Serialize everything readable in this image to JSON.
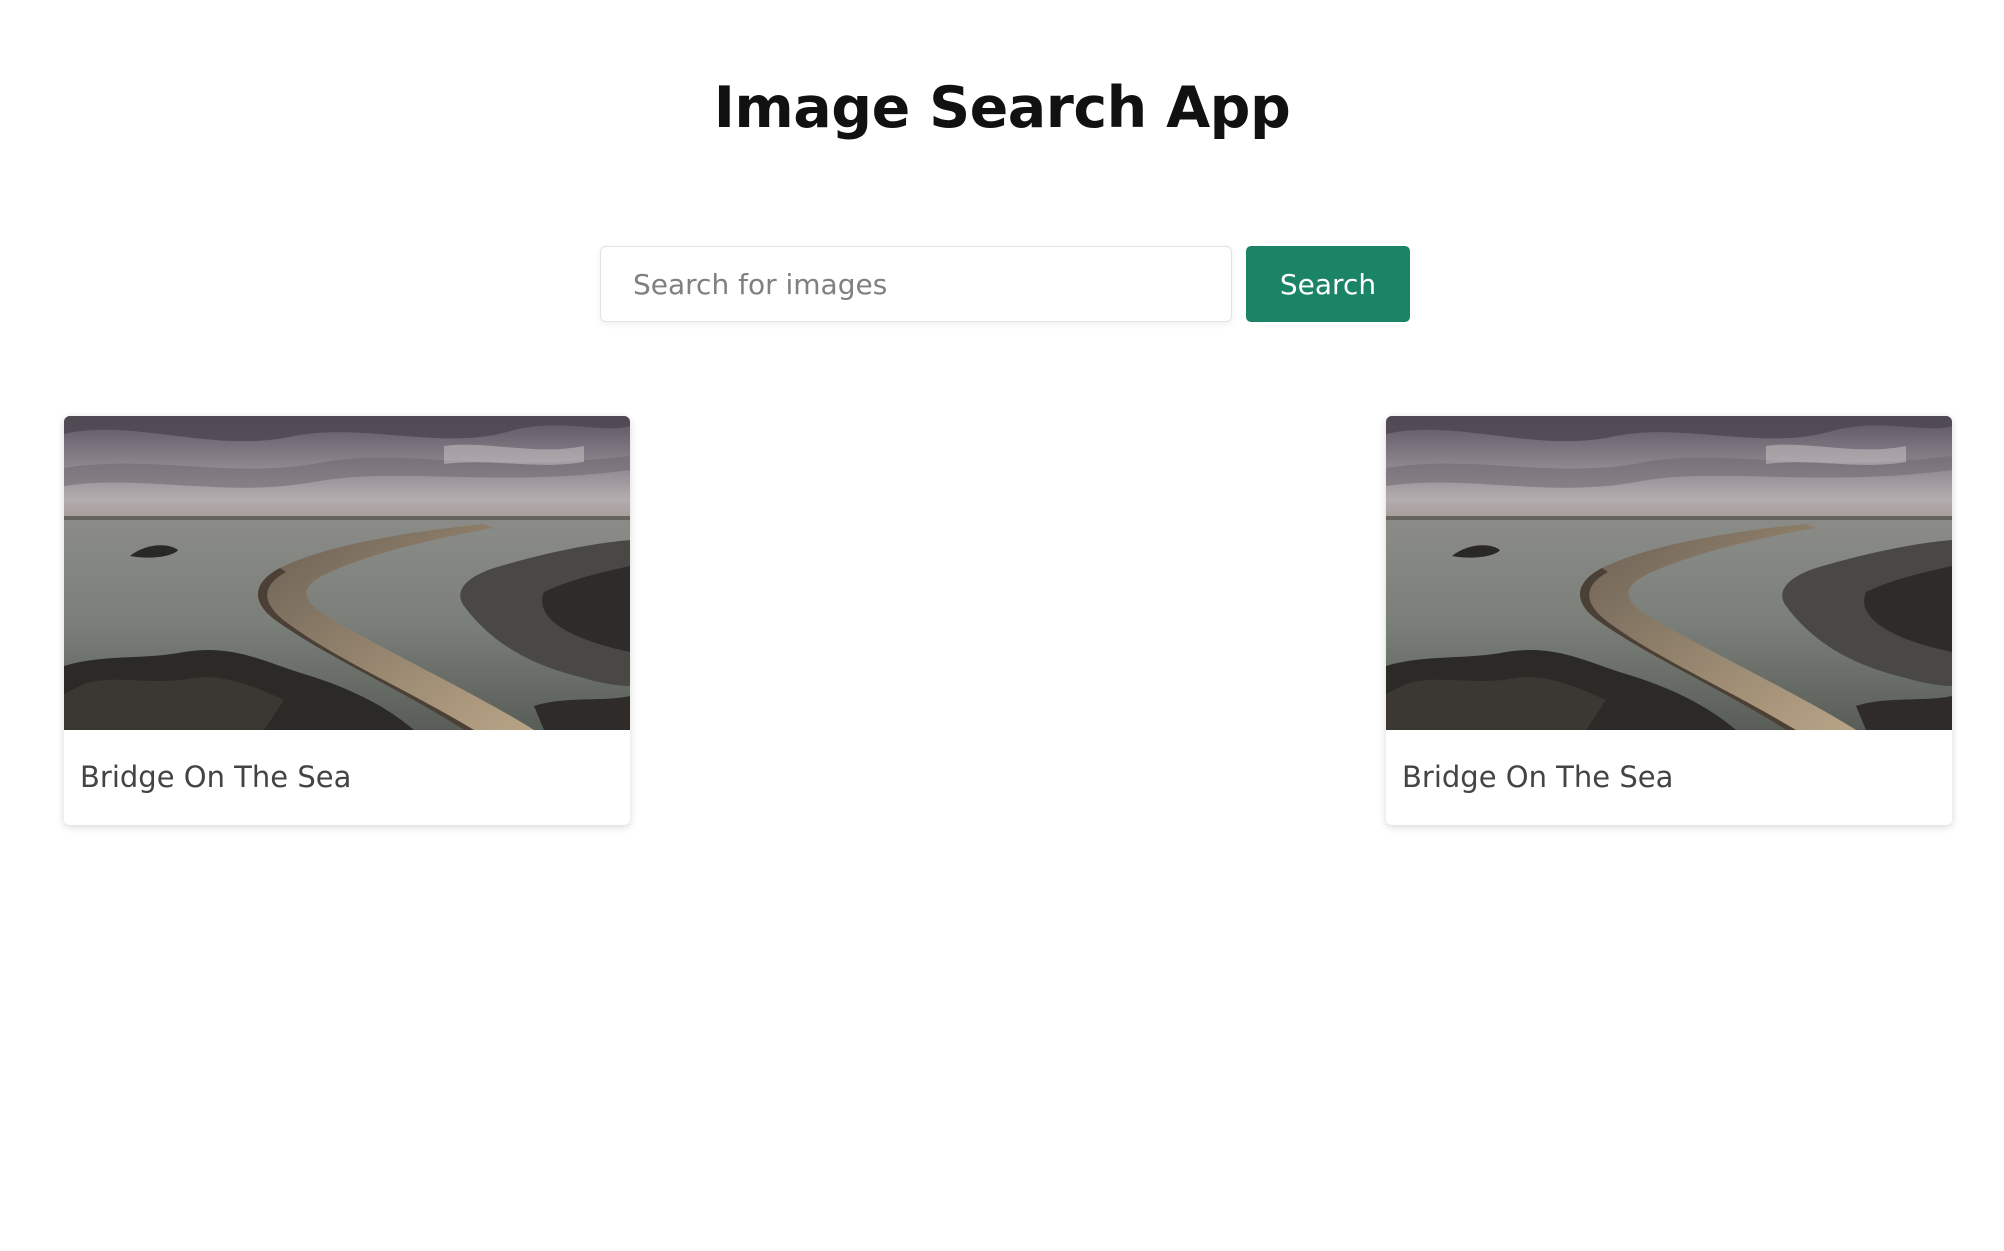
{
  "app": {
    "title": "Image Search App"
  },
  "search": {
    "placeholder": "Search for images",
    "value": "",
    "button_label": "Search"
  },
  "results": [
    {
      "caption": "Bridge On The Sea",
      "image": "seascape-stone-pier-photo"
    },
    {
      "caption": "Bridge On The Sea",
      "image": "seascape-stone-pier-photo"
    }
  ],
  "colors": {
    "accent": "#1b8466",
    "title": "#111111",
    "caption": "#444444",
    "placeholder": "#808080"
  }
}
